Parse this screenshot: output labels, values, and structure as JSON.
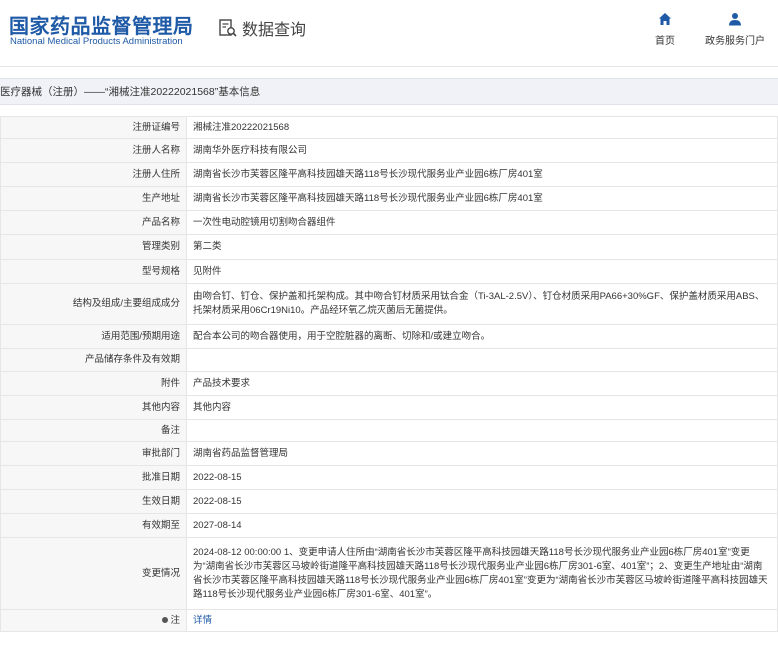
{
  "header": {
    "brand_cn": "国家药品监督管理局",
    "brand_en": "National Medical Products Administration",
    "section": "数据查询",
    "nav_home": "首页",
    "nav_portal": "政务服务门户"
  },
  "title": "医疗器械（注册）——“湘械注准20222021568”基本信息",
  "rows": [
    {
      "label": "注册证编号",
      "value": "湘械注准20222021568"
    },
    {
      "label": "注册人名称",
      "value": "湖南华外医疗科技有限公司"
    },
    {
      "label": "注册人住所",
      "value": "湖南省长沙市芙蓉区隆平高科技园雄天路118号长沙现代服务业产业园6栋厂房401室"
    },
    {
      "label": "生产地址",
      "value": "湖南省长沙市芙蓉区隆平高科技园雄天路118号长沙现代服务业产业园6栋厂房401室"
    },
    {
      "label": "产品名称",
      "value": "一次性电动腔镜用切割吻合器组件"
    },
    {
      "label": "管理类别",
      "value": "第二类"
    },
    {
      "label": "型号规格",
      "value": "见附件"
    },
    {
      "label": "结构及组成/主要组成成分",
      "value": "由吻合钉、钉仓、保护盖和托架构成。其中吻合钉材质采用钛合金（Ti-3AL-2.5V）、钉仓材质采用PA66+30%GF、保护盖材质采用ABS、托架材质采用06Cr19Ni10。产品经环氧乙烷灭菌后无菌提供。"
    },
    {
      "label": "适用范围/预期用途",
      "value": "配合本公司的吻合器使用，用于空腔脏器的离断、切除和/或建立吻合。"
    },
    {
      "label": "产品储存条件及有效期",
      "value": ""
    },
    {
      "label": "附件",
      "value": "产品技术要求"
    },
    {
      "label": "其他内容",
      "value": "其他内容"
    },
    {
      "label": "备注",
      "value": ""
    },
    {
      "label": "审批部门",
      "value": "湖南省药品监督管理局"
    },
    {
      "label": "批准日期",
      "value": "2022-08-15"
    },
    {
      "label": "生效日期",
      "value": "2022-08-15"
    },
    {
      "label": "有效期至",
      "value": "2027-08-14"
    },
    {
      "label": "变更情况",
      "value": "2024-08-12 00:00:00 1、变更申请人住所由“湖南省长沙市芙蓉区隆平高科技园雄天路118号长沙现代服务业产业园6栋厂房401室”变更为“湖南省长沙市芙蓉区马坡岭街道隆平高科技园雄天路118号长沙现代服务业产业园6栋厂房301-6室、401室”；2、变更生产地址由“湖南省长沙市芙蓉区隆平高科技园雄天路118号长沙现代服务业产业园6栋厂房401室”变更为“湖南省长沙市芙蓉区马坡岭街道隆平高科技园雄天路118号长沙现代服务业产业园6栋厂房301-6室、401室”。"
    },
    {
      "label": "注",
      "value": "详情"
    }
  ]
}
